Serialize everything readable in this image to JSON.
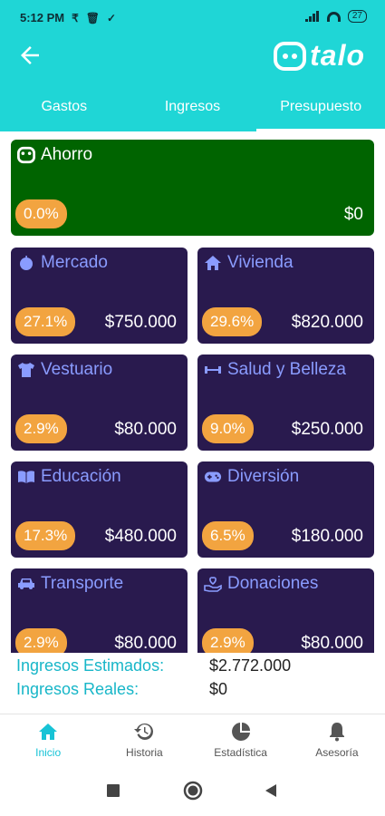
{
  "status_bar": {
    "time": "5:12 PM",
    "battery": "27"
  },
  "header": {
    "logo_text": "talo"
  },
  "tabs": [
    {
      "label": "Gastos",
      "active": false
    },
    {
      "label": "Ingresos",
      "active": false
    },
    {
      "label": "Presupuesto",
      "active": true
    }
  ],
  "savings": {
    "title": "Ahorro",
    "percent": "0.0%",
    "amount": "$0",
    "color": "#006400"
  },
  "categories": [
    {
      "title": "Mercado",
      "icon": "apple-icon",
      "percent": "27.1%",
      "amount": "$750.000"
    },
    {
      "title": "Vivienda",
      "icon": "home-icon",
      "percent": "29.6%",
      "amount": "$820.000"
    },
    {
      "title": "Vestuario",
      "icon": "shirt-icon",
      "percent": "2.9%",
      "amount": "$80.000"
    },
    {
      "title": "Salud y Belleza",
      "icon": "dumbbell-icon",
      "percent": "9.0%",
      "amount": "$250.000"
    },
    {
      "title": "Educación",
      "icon": "book-icon",
      "percent": "17.3%",
      "amount": "$480.000"
    },
    {
      "title": "Diversión",
      "icon": "gamepad-icon",
      "percent": "6.5%",
      "amount": "$180.000"
    },
    {
      "title": "Transporte",
      "icon": "car-icon",
      "percent": "2.9%",
      "amount": "$80.000"
    },
    {
      "title": "Donaciones",
      "icon": "hand-heart-icon",
      "percent": "2.9%",
      "amount": "$80.000"
    }
  ],
  "summary": {
    "estimated_label": "Ingresos Estimados:",
    "estimated_value": "$2.772.000",
    "real_label": "Ingresos Reales:",
    "real_value": "$0"
  },
  "bottom_nav": [
    {
      "label": "Inicio",
      "icon": "home-icon",
      "active": true
    },
    {
      "label": "Historia",
      "icon": "history-icon",
      "active": false
    },
    {
      "label": "Estadística",
      "icon": "pie-chart-icon",
      "active": false
    },
    {
      "label": "Asesoría",
      "icon": "bell-icon",
      "active": false
    }
  ],
  "colors": {
    "accent": "#1fd6d6",
    "card": "#291a4e",
    "card_title": "#8a9cff",
    "badge": "#f2a440",
    "summary_label": "#17b6c8",
    "nav_active": "#17c3d6"
  }
}
